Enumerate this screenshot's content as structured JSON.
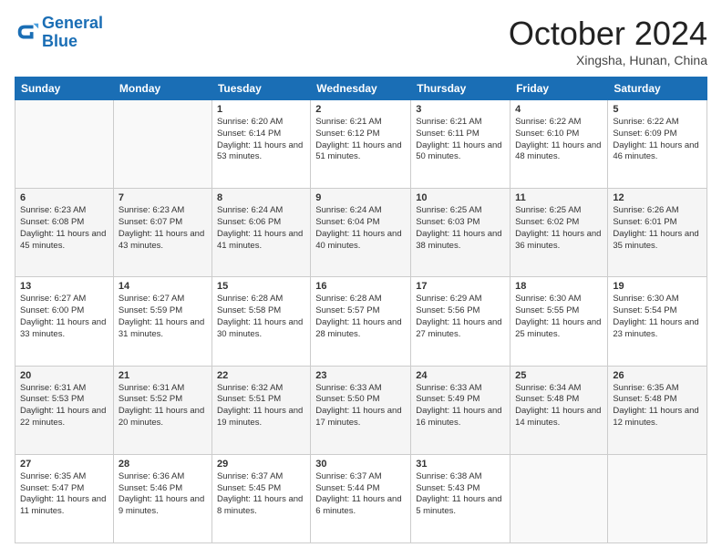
{
  "header": {
    "logo_line1": "General",
    "logo_line2": "Blue",
    "month": "October 2024",
    "location": "Xingsha, Hunan, China"
  },
  "days_of_week": [
    "Sunday",
    "Monday",
    "Tuesday",
    "Wednesday",
    "Thursday",
    "Friday",
    "Saturday"
  ],
  "weeks": [
    [
      {
        "day": "",
        "info": ""
      },
      {
        "day": "",
        "info": ""
      },
      {
        "day": "1",
        "info": "Sunrise: 6:20 AM\nSunset: 6:14 PM\nDaylight: 11 hours and 53 minutes."
      },
      {
        "day": "2",
        "info": "Sunrise: 6:21 AM\nSunset: 6:12 PM\nDaylight: 11 hours and 51 minutes."
      },
      {
        "day": "3",
        "info": "Sunrise: 6:21 AM\nSunset: 6:11 PM\nDaylight: 11 hours and 50 minutes."
      },
      {
        "day": "4",
        "info": "Sunrise: 6:22 AM\nSunset: 6:10 PM\nDaylight: 11 hours and 48 minutes."
      },
      {
        "day": "5",
        "info": "Sunrise: 6:22 AM\nSunset: 6:09 PM\nDaylight: 11 hours and 46 minutes."
      }
    ],
    [
      {
        "day": "6",
        "info": "Sunrise: 6:23 AM\nSunset: 6:08 PM\nDaylight: 11 hours and 45 minutes."
      },
      {
        "day": "7",
        "info": "Sunrise: 6:23 AM\nSunset: 6:07 PM\nDaylight: 11 hours and 43 minutes."
      },
      {
        "day": "8",
        "info": "Sunrise: 6:24 AM\nSunset: 6:06 PM\nDaylight: 11 hours and 41 minutes."
      },
      {
        "day": "9",
        "info": "Sunrise: 6:24 AM\nSunset: 6:04 PM\nDaylight: 11 hours and 40 minutes."
      },
      {
        "day": "10",
        "info": "Sunrise: 6:25 AM\nSunset: 6:03 PM\nDaylight: 11 hours and 38 minutes."
      },
      {
        "day": "11",
        "info": "Sunrise: 6:25 AM\nSunset: 6:02 PM\nDaylight: 11 hours and 36 minutes."
      },
      {
        "day": "12",
        "info": "Sunrise: 6:26 AM\nSunset: 6:01 PM\nDaylight: 11 hours and 35 minutes."
      }
    ],
    [
      {
        "day": "13",
        "info": "Sunrise: 6:27 AM\nSunset: 6:00 PM\nDaylight: 11 hours and 33 minutes."
      },
      {
        "day": "14",
        "info": "Sunrise: 6:27 AM\nSunset: 5:59 PM\nDaylight: 11 hours and 31 minutes."
      },
      {
        "day": "15",
        "info": "Sunrise: 6:28 AM\nSunset: 5:58 PM\nDaylight: 11 hours and 30 minutes."
      },
      {
        "day": "16",
        "info": "Sunrise: 6:28 AM\nSunset: 5:57 PM\nDaylight: 11 hours and 28 minutes."
      },
      {
        "day": "17",
        "info": "Sunrise: 6:29 AM\nSunset: 5:56 PM\nDaylight: 11 hours and 27 minutes."
      },
      {
        "day": "18",
        "info": "Sunrise: 6:30 AM\nSunset: 5:55 PM\nDaylight: 11 hours and 25 minutes."
      },
      {
        "day": "19",
        "info": "Sunrise: 6:30 AM\nSunset: 5:54 PM\nDaylight: 11 hours and 23 minutes."
      }
    ],
    [
      {
        "day": "20",
        "info": "Sunrise: 6:31 AM\nSunset: 5:53 PM\nDaylight: 11 hours and 22 minutes."
      },
      {
        "day": "21",
        "info": "Sunrise: 6:31 AM\nSunset: 5:52 PM\nDaylight: 11 hours and 20 minutes."
      },
      {
        "day": "22",
        "info": "Sunrise: 6:32 AM\nSunset: 5:51 PM\nDaylight: 11 hours and 19 minutes."
      },
      {
        "day": "23",
        "info": "Sunrise: 6:33 AM\nSunset: 5:50 PM\nDaylight: 11 hours and 17 minutes."
      },
      {
        "day": "24",
        "info": "Sunrise: 6:33 AM\nSunset: 5:49 PM\nDaylight: 11 hours and 16 minutes."
      },
      {
        "day": "25",
        "info": "Sunrise: 6:34 AM\nSunset: 5:48 PM\nDaylight: 11 hours and 14 minutes."
      },
      {
        "day": "26",
        "info": "Sunrise: 6:35 AM\nSunset: 5:48 PM\nDaylight: 11 hours and 12 minutes."
      }
    ],
    [
      {
        "day": "27",
        "info": "Sunrise: 6:35 AM\nSunset: 5:47 PM\nDaylight: 11 hours and 11 minutes."
      },
      {
        "day": "28",
        "info": "Sunrise: 6:36 AM\nSunset: 5:46 PM\nDaylight: 11 hours and 9 minutes."
      },
      {
        "day": "29",
        "info": "Sunrise: 6:37 AM\nSunset: 5:45 PM\nDaylight: 11 hours and 8 minutes."
      },
      {
        "day": "30",
        "info": "Sunrise: 6:37 AM\nSunset: 5:44 PM\nDaylight: 11 hours and 6 minutes."
      },
      {
        "day": "31",
        "info": "Sunrise: 6:38 AM\nSunset: 5:43 PM\nDaylight: 11 hours and 5 minutes."
      },
      {
        "day": "",
        "info": ""
      },
      {
        "day": "",
        "info": ""
      }
    ]
  ]
}
